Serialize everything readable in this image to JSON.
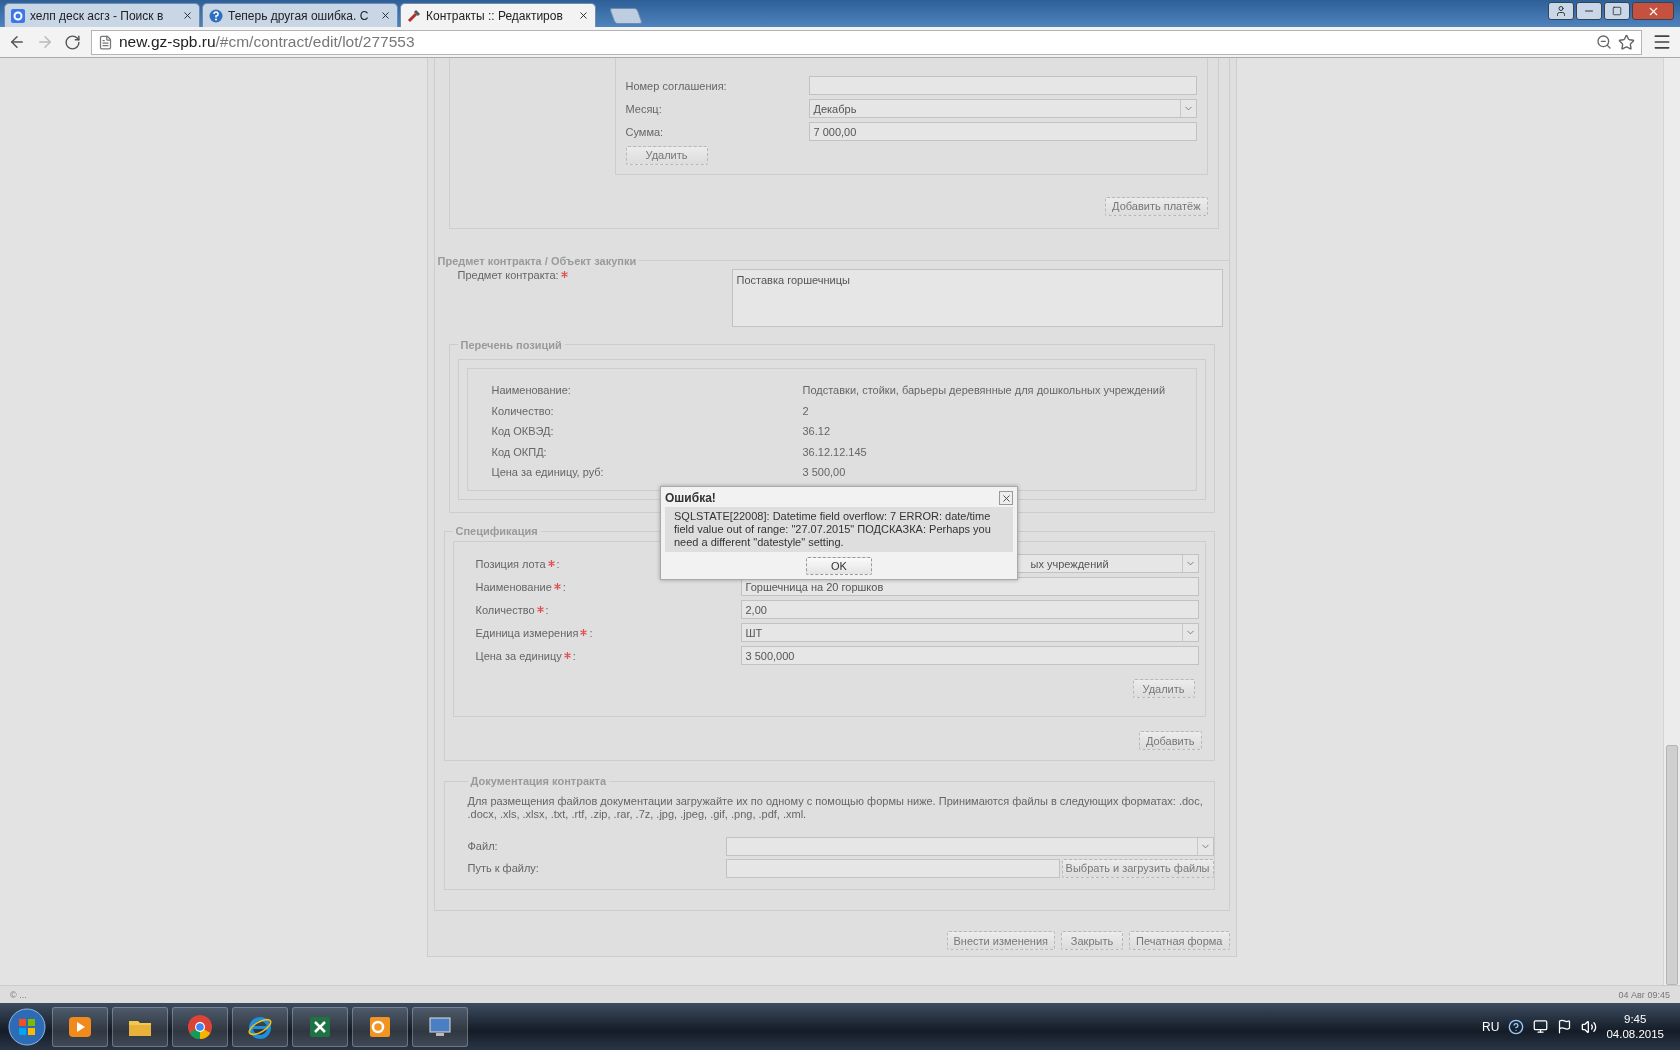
{
  "browser": {
    "tabs": [
      {
        "title": "хелп деск асгз - Поиск в",
        "selected": false
      },
      {
        "title": "Теперь другая ошибка. С",
        "selected": false
      },
      {
        "title": "Контракты :: Редактиров",
        "selected": true
      }
    ],
    "url": {
      "host": "new.gz-spb.ru",
      "path": "/#cm/contract/edit/lot/277553"
    }
  },
  "payment": {
    "fields": [
      {
        "label": "Номер соглашения:",
        "kind": "text"
      },
      {
        "label": "Месяц:",
        "kind": "select",
        "value": "Декабрь"
      },
      {
        "label": "Сумма:",
        "kind": "text",
        "value": "7 000,00"
      }
    ],
    "delete_button": "Удалить",
    "add_button": "Добавить платёж"
  },
  "subject": {
    "legend": "Предмет контракта / Объект закупки",
    "label": "Предмет контракта:",
    "required": true,
    "value": "Поставка горшечницы"
  },
  "positions": {
    "legend": "Перечень позиций",
    "rows": [
      {
        "label": "Наименование:",
        "value": "Подставки, стойки, барьеры деревянные для дошкольных учреждений"
      },
      {
        "label": "Количество:",
        "value": "2"
      },
      {
        "label": "Код ОКВЭД:",
        "value": "36.12"
      },
      {
        "label": "Код ОКПД:",
        "value": "36.12.12.145"
      },
      {
        "label": "Цена за единицу, руб:",
        "value": "3 500,00"
      }
    ]
  },
  "specification": {
    "legend": "Спецификация",
    "fields": [
      {
        "label": "Позиция лота",
        "suffix": ":",
        "required": true,
        "kind": "select",
        "value": "ых учреждений"
      },
      {
        "label": "Наименование",
        "suffix": ":",
        "required": true,
        "kind": "text",
        "value": "Горшечница на 20 горшков"
      },
      {
        "label": "Количество",
        "suffix": ":",
        "required": true,
        "kind": "text",
        "value": "2,00"
      },
      {
        "label": "Единица измерения",
        "suffix": ":",
        "required": true,
        "kind": "select",
        "value": "ШТ"
      },
      {
        "label": "Цена за единицу",
        "suffix": ":",
        "required": true,
        "kind": "text",
        "value": "3 500,000"
      }
    ],
    "delete_button": "Удалить",
    "add_button": "Добавить"
  },
  "documents": {
    "legend": "Документация контракта",
    "note": "Для размещения файлов документации загружайте их по одному с помощью формы ниже. Принимаются файлы в следующих форматах: .doc, .docx, .xls, .xlsx, .txt, .rtf, .zip, .rar, .7z, .jpg, .jpeg, .gif, .png, .pdf, .xml.",
    "fields": [
      {
        "label": "Файл:",
        "kind": "select"
      },
      {
        "label": "Путь к файлу:",
        "kind": "upload",
        "button": "Выбрать и загрузить файлы"
      }
    ]
  },
  "actions": [
    "Внести изменения",
    "Закрыть",
    "Печатная форма"
  ],
  "dialog": {
    "title": "Ошибка!",
    "message": "SQLSTATE[22008]: Datetime field overflow: 7 ERROR: date/time field value out of range: \"27.07.2015\" ПОДСКАЗКА: Perhaps you need a different \"datestyle\" setting.",
    "button": "OK"
  },
  "status_bar": {
    "left": "© ...",
    "right": "04 Авг 09:45"
  },
  "taskbar": {
    "apps": [
      {
        "kind": "media"
      },
      {
        "kind": "explorer"
      },
      {
        "kind": "chrome"
      },
      {
        "kind": "ie"
      },
      {
        "kind": "excel"
      },
      {
        "kind": "outlook"
      },
      {
        "kind": "network"
      }
    ],
    "language": "RU",
    "time": "9:45",
    "date": "04.08.2015"
  }
}
